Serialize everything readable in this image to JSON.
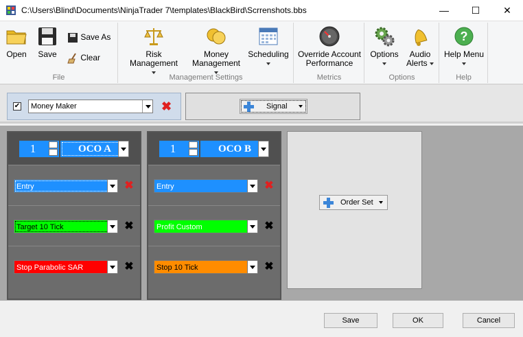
{
  "window": {
    "title": "C:\\Users\\Blind\\Documents\\NinjaTrader 7\\templates\\BlackBird\\Scrrenshots.bbs",
    "minimize": "—",
    "maximize": "☐",
    "close": "✕"
  },
  "ribbon": {
    "file": {
      "open": "Open",
      "save": "Save",
      "save_as": "Save  As",
      "clear": "Clear",
      "label": "File"
    },
    "management": {
      "risk": "Risk Management",
      "money_line1": "Money",
      "money_line2": "Management",
      "scheduling": "Scheduling",
      "label": "Management Settings"
    },
    "metrics": {
      "override_line1": "Override Account",
      "override_line2": "Performance",
      "label": "Metrics"
    },
    "options": {
      "options": "Options",
      "audio_line1": "Audio",
      "audio_line2": "Alerts",
      "label": "Options"
    },
    "help": {
      "help_menu": "Help Menu",
      "label": "Help"
    }
  },
  "toolbar": {
    "strategy_checked": "✔",
    "strategy_value": "Money Maker",
    "signal_label": "Signal"
  },
  "oco_a": {
    "count": "1",
    "name": "OCO A",
    "rows": [
      {
        "value": "Entry",
        "color": "#1e90ff"
      },
      {
        "value": "Target 10 Tick",
        "color": "#00ff00"
      },
      {
        "value": "Stop Parabolic SAR",
        "color": "#ff0000"
      }
    ]
  },
  "oco_b": {
    "count": "1",
    "name": "OCO B",
    "rows": [
      {
        "value": "Entry",
        "color": "#1e90ff"
      },
      {
        "value": "Profit Custom",
        "color": "#00ff00"
      },
      {
        "value": "Stop 10 Tick",
        "color": "#ff8c00"
      }
    ]
  },
  "order_set": {
    "label": "Order Set"
  },
  "footer": {
    "save": "Save",
    "ok": "OK",
    "cancel": "Cancel"
  },
  "icons": {
    "remove": "✖"
  }
}
